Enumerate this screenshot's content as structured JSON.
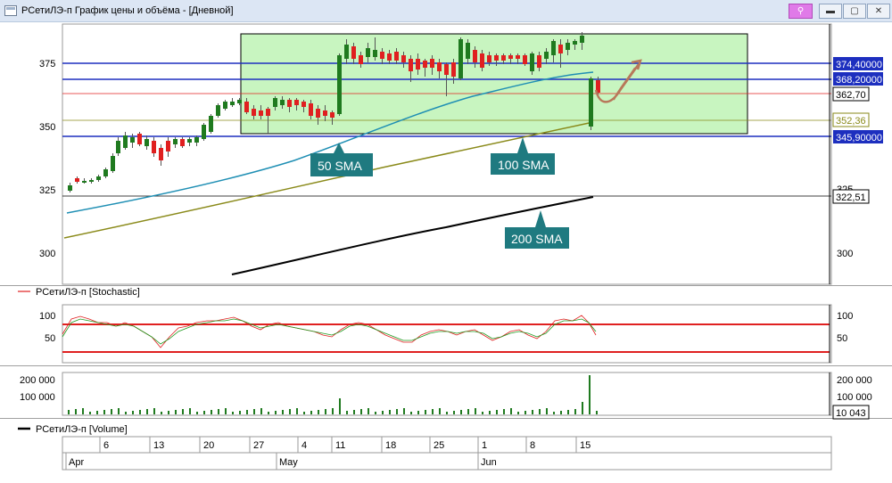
{
  "window": {
    "title": "РСетиЛЭ-п График цены и объёма - [Дневной]",
    "buttons": {
      "pin": "⚲",
      "minimize": "▬",
      "maximize": "▢",
      "close": "✕"
    },
    "pin_color": "#e07ae8"
  },
  "price_panel": {
    "y_ticks_left": [
      "375",
      "350",
      "325",
      "300"
    ],
    "y_ticks_right": [
      "325",
      "300"
    ],
    "price_labels": [
      {
        "text": "374,40000",
        "style": "blue"
      },
      {
        "text": "368,20000",
        "style": "blue"
      },
      {
        "text": "362,70",
        "style": "plain"
      },
      {
        "text": "352,36",
        "style": "olive"
      },
      {
        "text": "345,90000",
        "style": "blue"
      },
      {
        "text": "322,51",
        "style": "plain"
      }
    ],
    "sma_callouts": [
      "50 SMA",
      "100 SMA",
      "200 SMA"
    ],
    "colors": {
      "up_candle": "#1f7a1f",
      "down_candle": "#e02020",
      "zone_fill": "#c8f5c0",
      "sma50": "#1f8fb4",
      "sma100": "#8a8a1a",
      "sma200": "#000000",
      "level_blue": "#1d2fbf",
      "callout": "#1f7a80",
      "arrow": "#b8785a"
    }
  },
  "stochastic_panel": {
    "legend": "РСетиЛЭ-п [Stochastic]",
    "ticks_left": [
      "100",
      "50"
    ],
    "ticks_right": [
      "100",
      "50"
    ]
  },
  "volume_panel": {
    "ticks_left": [
      "200 000",
      "100 000"
    ],
    "ticks_right": [
      "200 000",
      "100 000"
    ],
    "last_value": "10 043",
    "legend": "РСетиЛЭ-п [Volume]"
  },
  "time_axis": {
    "days": [
      "6",
      "13",
      "20",
      "27",
      "4",
      "11",
      "18",
      "25",
      "1",
      "8",
      "15"
    ],
    "months": [
      "Apr",
      "May",
      "Jun"
    ]
  }
}
